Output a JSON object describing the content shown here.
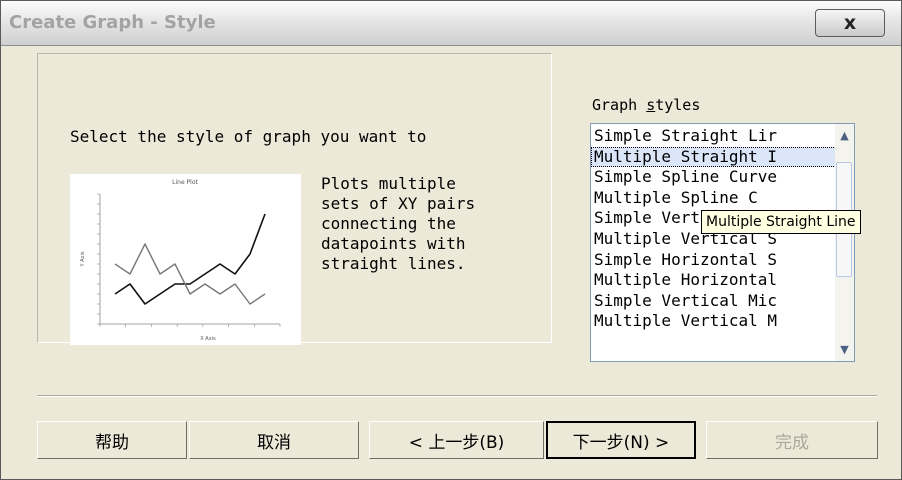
{
  "window": {
    "title": "Create Graph - Style",
    "close_label": "x"
  },
  "panel": {
    "instruction": "Select the style of graph you want to",
    "description": [
      "Plots multiple",
      "sets of XY pairs",
      "connecting the",
      "datapoints with",
      "straight lines."
    ]
  },
  "preview": {
    "title": "Line Plot",
    "xlabel": "X Axis",
    "ylabel": "Y Axis"
  },
  "chart_data": {
    "type": "line",
    "title": "Line Plot",
    "xlabel": "X Axis",
    "ylabel": "Y Axis",
    "x": [
      1,
      2,
      3,
      4,
      5,
      6,
      7,
      8,
      9,
      10,
      11
    ],
    "series": [
      {
        "values": [
          3,
          4,
          2,
          3,
          4,
          4,
          5,
          6,
          5,
          7,
          11
        ]
      },
      {
        "values": [
          6,
          5,
          8,
          5,
          6,
          3,
          4,
          3,
          4,
          2,
          3
        ]
      }
    ],
    "ylim": [
      0,
      13
    ]
  },
  "styles": {
    "label_before": "Graph ",
    "label_mnemonic": "s",
    "label_after": "tyles",
    "items": [
      "Simple Straight Lir",
      "Multiple Straight I",
      "Simple Spline Curve",
      "Multiple Spline C",
      "Simple Vertical S",
      "Multiple Vertical S",
      "Simple Horizontal S",
      "Multiple Horizontal",
      "Simple Vertical Mic",
      "Multiple Vertical M"
    ],
    "selected_index": 1,
    "tooltip": "Multiple Straight Line"
  },
  "buttons": {
    "help": "帮助",
    "cancel": "取消",
    "back": "< 上一步(B)",
    "next": "下一步(N) >",
    "finish": "完成"
  },
  "icons": {
    "scroll_up": "scroll-up-arrow-icon",
    "scroll_down": "scroll-down-arrow-icon"
  }
}
